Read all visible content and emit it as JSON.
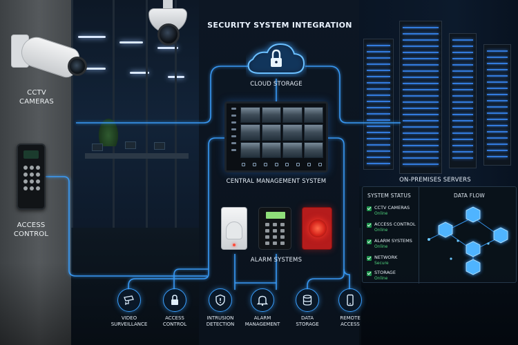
{
  "title": "SECURITY SYSTEM INTEGRATION",
  "cloud": {
    "label": "CLOUD STORAGE",
    "icon": "lock-icon"
  },
  "left": {
    "cctv_label": "CCTV\nCAMERAS",
    "access_label": "ACCESS\nCONTROL"
  },
  "central": {
    "label": "CENTRAL MANAGEMENT SYSTEM"
  },
  "alarm": {
    "label": "ALARM SYSTEMS"
  },
  "servers": {
    "label": "ON-PREMISES SERVERS"
  },
  "status_panel": {
    "heading": "SYSTEM STATUS",
    "items": [
      {
        "name": "CCTV CAMERAS",
        "state": "Online"
      },
      {
        "name": "ACCESS CONTROL",
        "state": "Online"
      },
      {
        "name": "ALARM SYSTEMS",
        "state": "Online"
      },
      {
        "name": "NETWORK",
        "state": "Secure"
      },
      {
        "name": "STORAGE",
        "state": "Online"
      }
    ],
    "flow_heading": "DATA FLOW"
  },
  "capabilities": [
    {
      "label": "VIDEO\nSURVEILLANCE",
      "icon": "cctv-camera-icon"
    },
    {
      "label": "ACCESS\nCONTROL",
      "icon": "padlock-icon"
    },
    {
      "label": "INTRUSION\nDETECTION",
      "icon": "shield-icon"
    },
    {
      "label": "ALARM\nMANAGEMENT",
      "icon": "bell-icon"
    },
    {
      "label": "DATA\nSTORAGE",
      "icon": "database-icon"
    },
    {
      "label": "REMOTE\nACCESS",
      "icon": "smartphone-icon"
    }
  ],
  "colors": {
    "accent": "#3aa0ff",
    "status_ok": "#4fd57e",
    "siren": "#b51c1c"
  }
}
